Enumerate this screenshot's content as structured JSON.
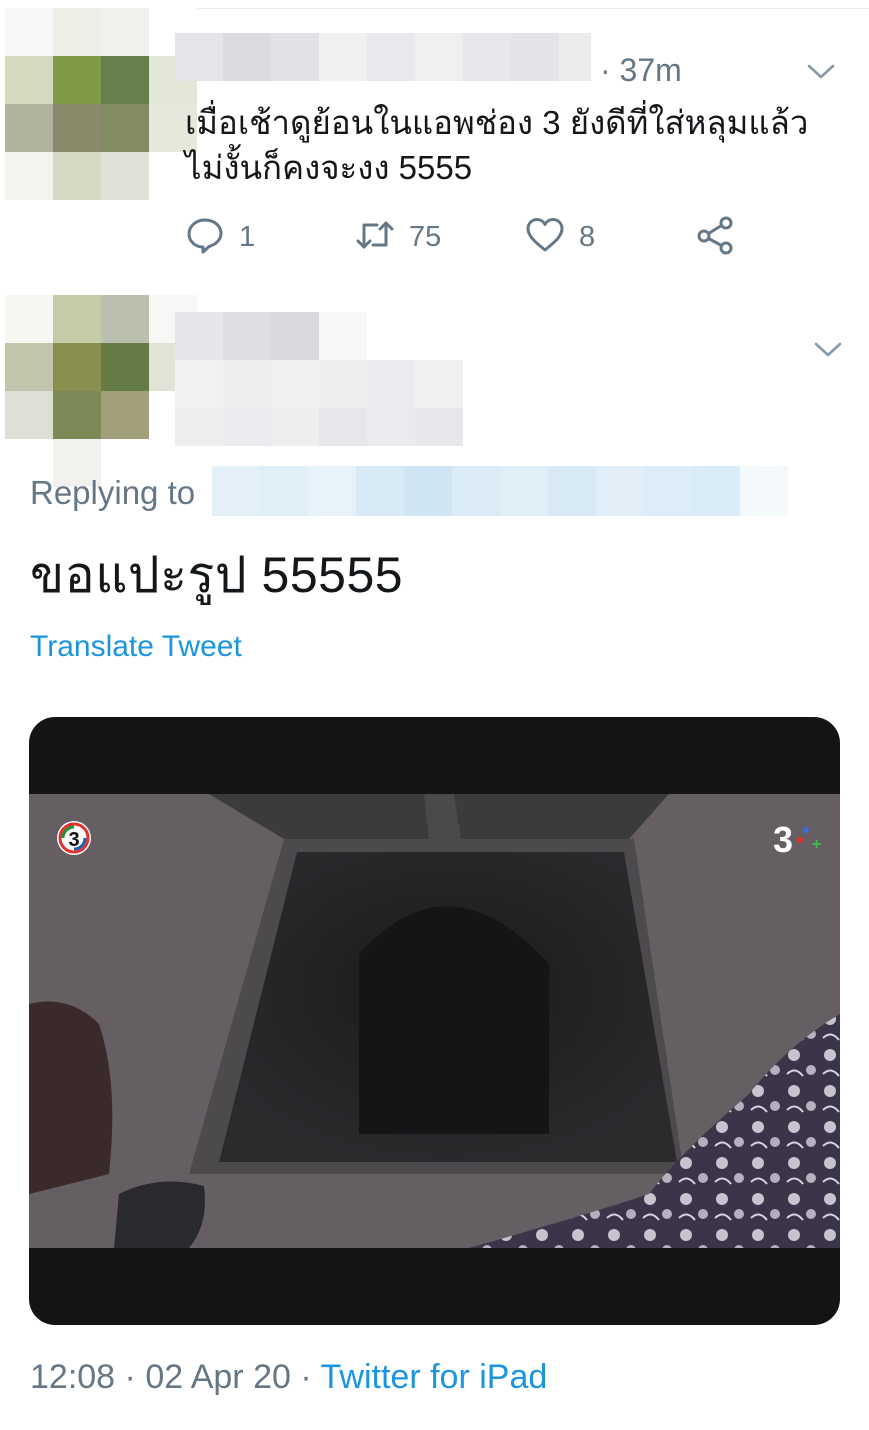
{
  "parent_tweet": {
    "time": "· 37m",
    "text": "เมื่อเช้าดูย้อนในแอพช่อง 3 ยังดีที่ใส่หลุมแล้ว ไม่งั้นก็คงจะงง 5555",
    "actions": {
      "reply_count": "1",
      "retweet_count": "75",
      "like_count": "8"
    },
    "icons": [
      "reply-icon",
      "retweet-icon",
      "like-icon",
      "share-icon"
    ]
  },
  "main_tweet": {
    "replying_to_label": "Replying to",
    "text": "ขอแปะรูป 55555",
    "translate_label": "Translate Tweet",
    "media": {
      "channel_logo_left": "3",
      "channel_logo_right": "3",
      "channel_logo_plus": "+"
    },
    "meta": {
      "time": "12:08",
      "separator": "·",
      "date": "02 Apr 20",
      "source": "Twitter for iPad"
    }
  },
  "colors": {
    "text_primary": "#14171a",
    "text_secondary": "#657786",
    "link": "#1b95e0",
    "divider": "#e6ecf0"
  }
}
